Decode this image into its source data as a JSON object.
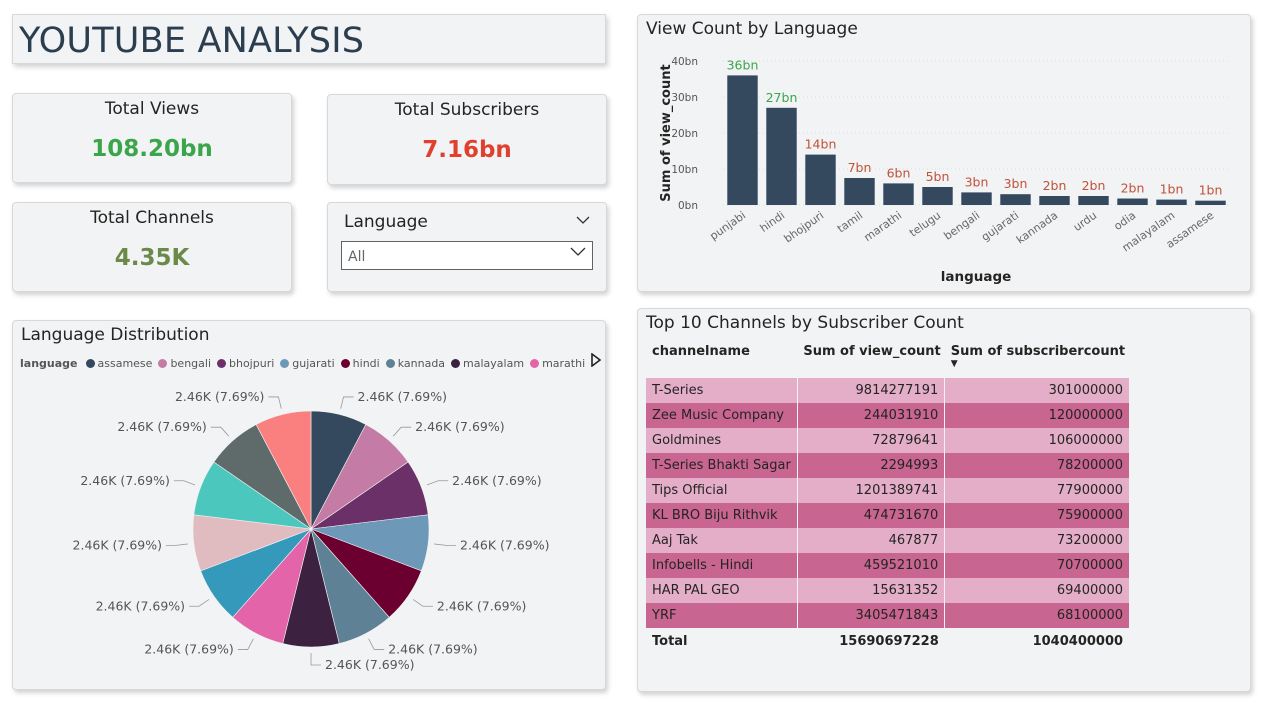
{
  "header": {
    "title": "YOUTUBE ANALYSIS"
  },
  "kpis": {
    "views": {
      "label": "Total Views",
      "value": "108.20bn",
      "color": "#3aa54a"
    },
    "subscribers": {
      "label": "Total Subscribers",
      "value": "7.16bn",
      "color": "#e0412f"
    },
    "channels": {
      "label": "Total Channels",
      "value": "4.35K",
      "color": "#6b8a4a"
    }
  },
  "slicer": {
    "label": "Language",
    "selected": "All"
  },
  "bar_chart": {
    "title": "View Count by Language",
    "chart_data": {
      "type": "bar",
      "categories": [
        "punjabi",
        "hindi",
        "bhojpuri",
        "tamil",
        "marathi",
        "telugu",
        "bengali",
        "gujarati",
        "kannada",
        "urdu",
        "odia",
        "malayalam",
        "assamese"
      ],
      "values": [
        36,
        27,
        14,
        7.5,
        6,
        5,
        3.5,
        3,
        2.5,
        2.5,
        1.8,
        1.5,
        1.2
      ],
      "data_labels": [
        "36bn",
        "27bn",
        "14bn",
        "7bn",
        "6bn",
        "5bn",
        "3bn",
        "3bn",
        "2bn",
        "2bn",
        "2bn",
        "1bn",
        "1bn"
      ],
      "label_colors": [
        "#3aa54a",
        "#3aa54a",
        "#c0533a",
        "#c0533a",
        "#c0533a",
        "#c0533a",
        "#c0533a",
        "#c0533a",
        "#c0533a",
        "#c0533a",
        "#c0533a",
        "#c0533a",
        "#c0533a"
      ],
      "bar_color": "#34495e",
      "xlabel": "language",
      "ylabel": "Sum of view_count",
      "yticks": [
        "0bn",
        "10bn",
        "20bn",
        "30bn",
        "40bn"
      ],
      "ylim": [
        0,
        40
      ],
      "grid": true
    }
  },
  "pie_chart": {
    "title": "Language Distribution",
    "legend_title": "language",
    "legend": [
      {
        "name": "assamese",
        "color": "#34495e"
      },
      {
        "name": "bengali",
        "color": "#c47ba5"
      },
      {
        "name": "bhojpuri",
        "color": "#6b3068"
      },
      {
        "name": "gujarati",
        "color": "#6e98b8"
      },
      {
        "name": "hindi",
        "color": "#6b0030"
      },
      {
        "name": "kannada",
        "color": "#5f8196"
      },
      {
        "name": "malayalam",
        "color": "#3c2240"
      },
      {
        "name": "marathi",
        "color": "#e364a8"
      }
    ],
    "chart_data": {
      "type": "pie",
      "slices": [
        {
          "value": 2.46,
          "label": "2.46K (7.69%)",
          "color": "#34495e"
        },
        {
          "value": 2.46,
          "label": "2.46K (7.69%)",
          "color": "#c47ba5"
        },
        {
          "value": 2.46,
          "label": "2.46K (7.69%)",
          "color": "#6b3068"
        },
        {
          "value": 2.46,
          "label": "2.46K (7.69%)",
          "color": "#6e98b8"
        },
        {
          "value": 2.46,
          "label": "2.46K (7.69%)",
          "color": "#6b0030"
        },
        {
          "value": 2.46,
          "label": "2.46K (7.69%)",
          "color": "#5f8196"
        },
        {
          "value": 2.46,
          "label": "2.46K (7.69%)",
          "color": "#3c2240"
        },
        {
          "value": 2.46,
          "label": "2.46K (7.69%)",
          "color": "#e364a8"
        },
        {
          "value": 2.46,
          "label": "2.46K (7.69%)",
          "color": "#3499bb"
        },
        {
          "value": 2.46,
          "label": "2.46K (7.69%)",
          "color": "#e0bcc0"
        },
        {
          "value": 2.46,
          "label": "2.46K (7.69%)",
          "color": "#4cc7bd"
        },
        {
          "value": 2.46,
          "label": "2.46K (7.69%)",
          "color": "#5f6b6b"
        },
        {
          "value": 2.46,
          "label": "2.46K (7.69%)",
          "color": "#fa8080"
        }
      ]
    }
  },
  "table": {
    "title": "Top 10 Channels by Subscriber Count",
    "columns": [
      "channelname",
      "Sum of view_count",
      "Sum of subscribercount"
    ],
    "rows": [
      [
        "T-Series",
        "9814277191",
        "301000000"
      ],
      [
        "Zee Music Company",
        "244031910",
        "120000000"
      ],
      [
        "Goldmines",
        "72879641",
        "106000000"
      ],
      [
        "T-Series Bhakti Sagar",
        "2294993",
        "78200000"
      ],
      [
        "Tips Official",
        "1201389741",
        "77900000"
      ],
      [
        "KL BRO Biju Rithvik",
        "474731670",
        "75900000"
      ],
      [
        "Aaj Tak",
        "467877",
        "73200000"
      ],
      [
        "Infobells - Hindi",
        "459521010",
        "70700000"
      ],
      [
        "HAR PAL GEO",
        "15631352",
        "69400000"
      ],
      [
        "YRF",
        "3405471843",
        "68100000"
      ]
    ],
    "total": [
      "Total",
      "15690697228",
      "1040400000"
    ]
  }
}
